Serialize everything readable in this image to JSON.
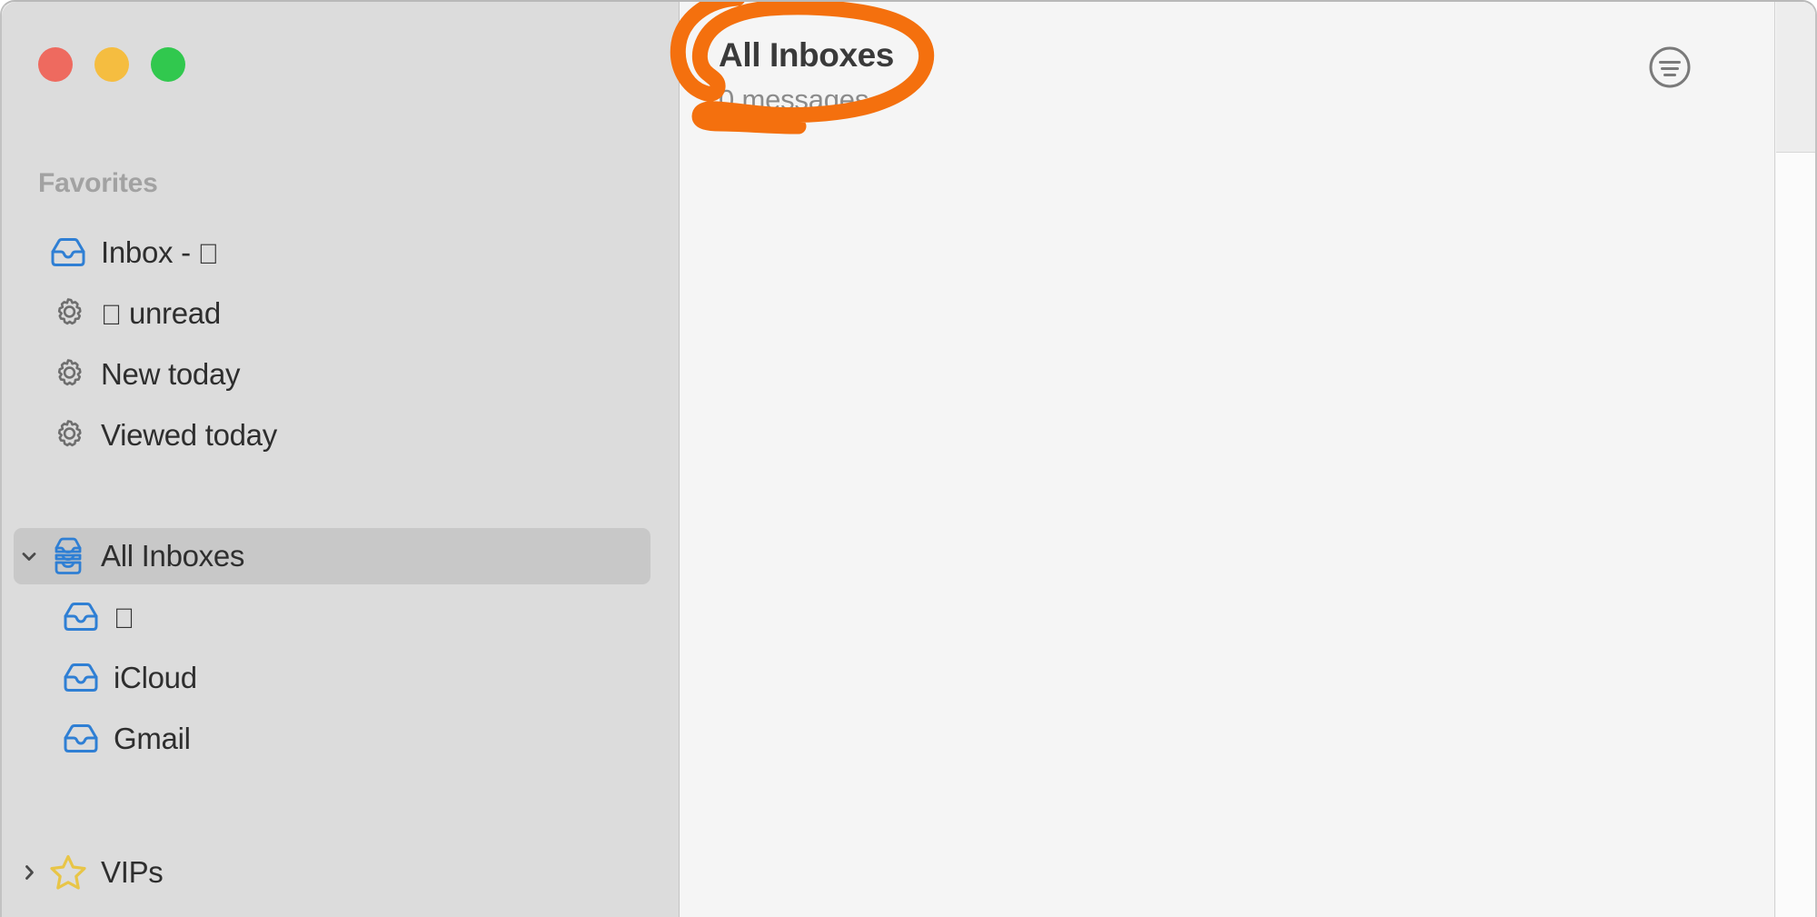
{
  "window": {
    "traffic_lights": [
      {
        "name": "close",
        "color": "#ee6a5f"
      },
      {
        "name": "minimize",
        "color": "#f5bd40"
      },
      {
        "name": "zoom",
        "color": "#31c84e"
      }
    ]
  },
  "sidebar": {
    "sections": [
      {
        "header": "Favorites",
        "items": [
          {
            "label": "Inbox - ",
            "text": "Inbox - ",
            "apple": true,
            "icon": "inbox-icon",
            "indent": 0,
            "selected": false,
            "disclosure": "none"
          },
          {
            "label": " unread",
            "text": "unread",
            "apple": true,
            "icon": "gear-icon",
            "indent": 0,
            "selected": false,
            "disclosure": "none",
            "apple_prefix": true
          },
          {
            "label": "New today",
            "text": "New today",
            "apple": false,
            "icon": "gear-icon",
            "indent": 0,
            "selected": false,
            "disclosure": "none"
          },
          {
            "label": "Viewed today",
            "text": "Viewed today",
            "apple": false,
            "icon": "gear-icon",
            "indent": 0,
            "selected": false,
            "disclosure": "none"
          },
          {
            "label": "All Inboxes",
            "text": "All Inboxes",
            "apple": false,
            "icon": "all-inboxes-icon",
            "indent": 0,
            "selected": true,
            "disclosure": "down"
          },
          {
            "label": "",
            "text": "",
            "apple": true,
            "icon": "inbox-icon",
            "indent": 1,
            "selected": false,
            "disclosure": "none"
          },
          {
            "label": "iCloud",
            "text": "iCloud",
            "apple": false,
            "icon": "inbox-icon",
            "indent": 1,
            "selected": false,
            "disclosure": "none"
          },
          {
            "label": "Gmail",
            "text": "Gmail",
            "apple": false,
            "icon": "inbox-icon",
            "indent": 1,
            "selected": false,
            "disclosure": "none"
          },
          {
            "label": "VIPs",
            "text": "VIPs",
            "apple": false,
            "icon": "star-icon",
            "indent": 0,
            "selected": false,
            "disclosure": "right"
          }
        ]
      }
    ]
  },
  "message_list": {
    "title": "All Inboxes",
    "subtitle": "0 messages",
    "filter_icon": "filter-circle-icon"
  },
  "annotation": {
    "shape": "hand-drawn-ellipse",
    "color": "#f4700e",
    "targets": [
      "All Inboxes",
      "0 messages"
    ]
  },
  "colors": {
    "sidebar_bg": "#dcdcdc",
    "content_bg": "#f5f5f5",
    "selected_row": "#c8c8c8",
    "inbox_blue": "#2f7fd4",
    "star_yellow": "#e8c547",
    "annotation_orange": "#f4700e",
    "title_text": "#3a3a3a",
    "subtitle_text": "#8b8b8b",
    "section_header_text": "#a2a2a2"
  }
}
